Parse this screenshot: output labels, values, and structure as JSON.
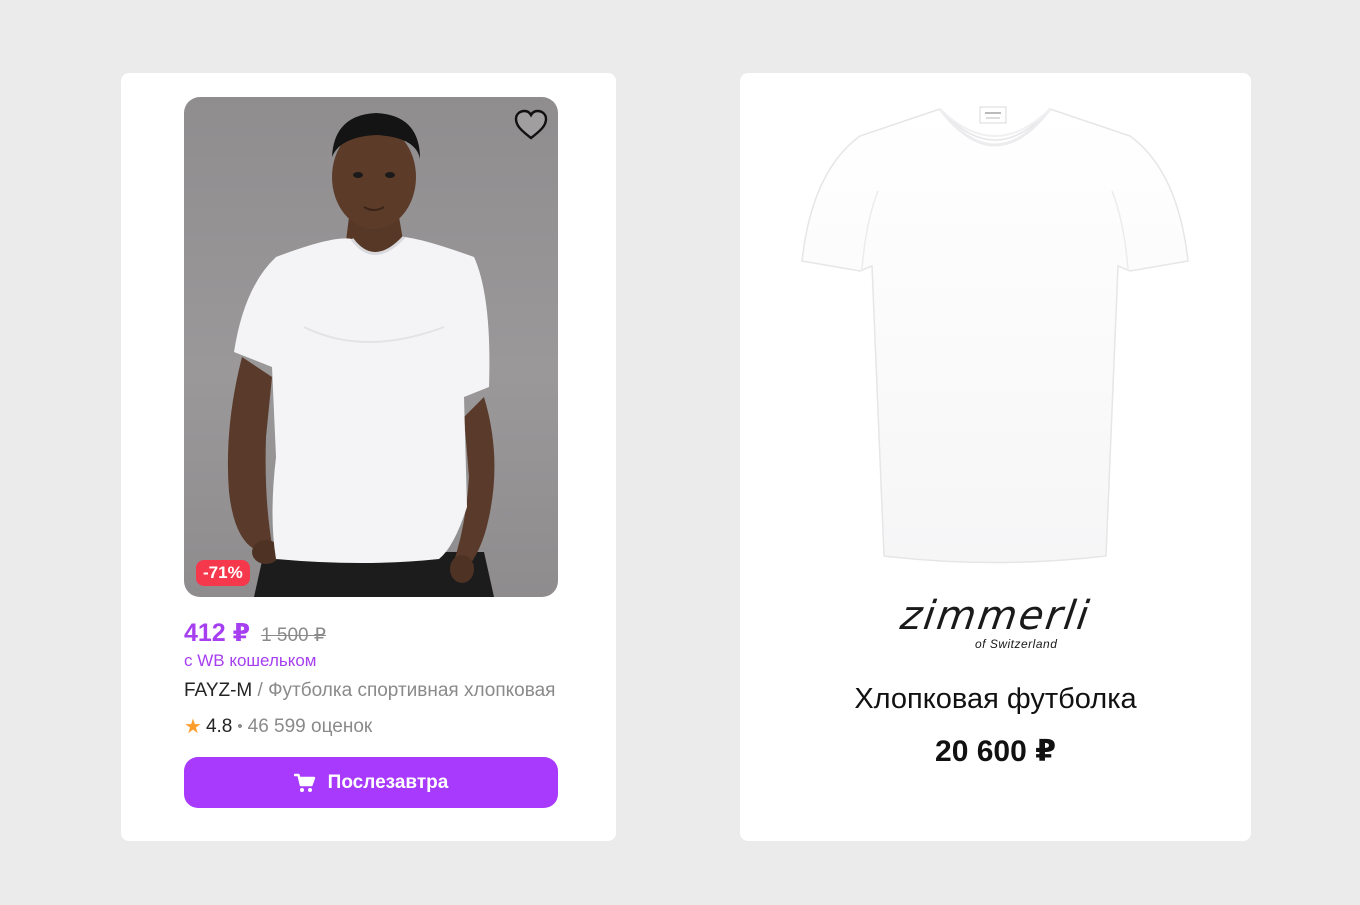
{
  "left_card": {
    "discount_badge": "-71%",
    "price": {
      "current": "412 ₽",
      "old": "1 500 ₽",
      "wallet_note": "с WB кошельком"
    },
    "brand": "FAYZ-M",
    "separator": " / ",
    "product_name": "Футболка спортивная хлопковая",
    "rating": {
      "value": "4.8",
      "dot": "•",
      "reviews": "46 599 оценок"
    },
    "buy_button_label": "Послезавтра",
    "icons": [
      "heart-icon",
      "star-icon",
      "cart-icon"
    ]
  },
  "right_card": {
    "logo_main": "zimmerli",
    "logo_sub": "of Switzerland",
    "title": "Хлопковая футболка",
    "price": "20 600 ₽"
  },
  "colors": {
    "background": "#ebebeb",
    "accent_purple": "#a73afd",
    "price_purple": "#a63ff0",
    "discount_red": "#f5384b",
    "star_orange": "#ff9e2c"
  }
}
